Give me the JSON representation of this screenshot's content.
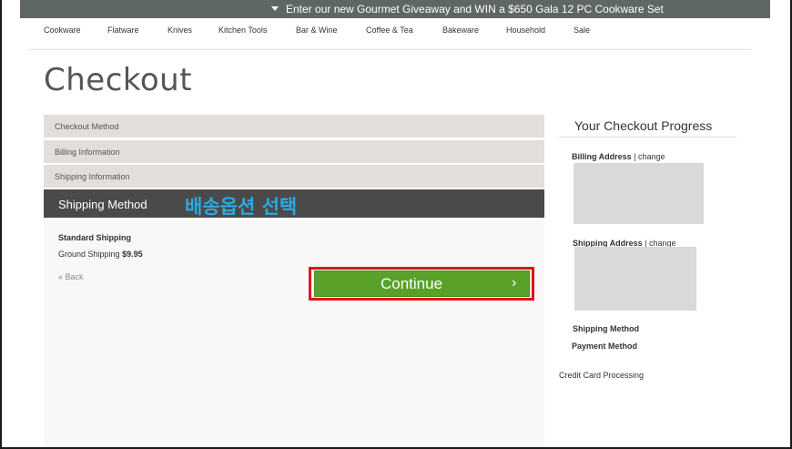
{
  "promo": {
    "text": "Enter our new Gourmet Giveaway and WIN a $650 Gala 12 PC Cookware Set"
  },
  "nav": {
    "items": [
      "Cookware",
      "Flatware",
      "Knives",
      "Kitchen Tools",
      "Bar & Wine",
      "Coffee & Tea",
      "Bakeware",
      "Household",
      "Sale"
    ]
  },
  "page": {
    "title": "Checkout"
  },
  "steps": {
    "checkout_method": "Checkout Method",
    "billing_information": "Billing Information",
    "shipping_information": "Shipping Information",
    "shipping_method": "Shipping Method"
  },
  "annotation": {
    "text": "배송옵션 선택"
  },
  "shipping": {
    "title": "Standard Shipping",
    "option_name": "Ground Shipping",
    "option_price": "$9.95",
    "back_label": "« Back",
    "continue_label": "Continue",
    "continue_chevron": "›"
  },
  "progress": {
    "title": "Your Checkout Progress",
    "billing_address": "Billing Address",
    "shipping_address": "Shipping Address",
    "separator": " | ",
    "change_label": "change",
    "shipping_method": "Shipping Method",
    "payment_method": "Payment Method",
    "credit_card_processing": "Credit Card Processing"
  },
  "colors": {
    "promo_bar": "#5f6666",
    "active_step": "#4a4a4a",
    "continue_button": "#5aa12a",
    "highlight_outline": "#e0141c",
    "annotation_text": "#2aa9e0"
  },
  "icons": {
    "promo_arrow": "caret-down-icon",
    "continue_chevron": "chevron-right-icon"
  }
}
